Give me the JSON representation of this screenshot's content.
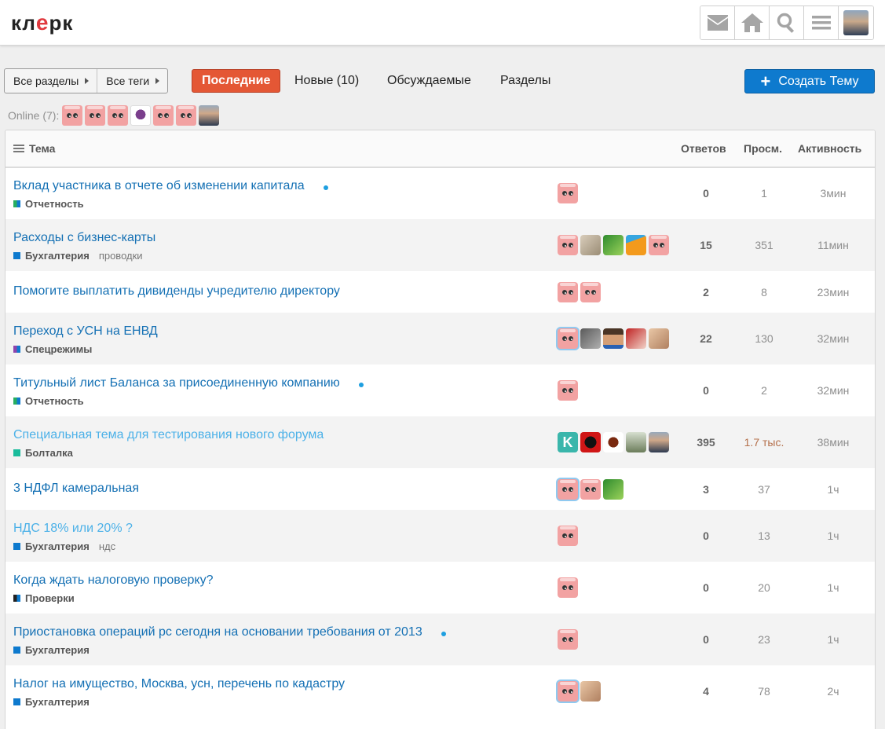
{
  "header": {
    "logo_text": "кл",
    "logo_clip": "e",
    "logo_tail": "рк",
    "icons": [
      "envelope-icon",
      "home-icon",
      "search-icon",
      "menu-icon"
    ]
  },
  "nav": {
    "categories_label": "Все разделы",
    "tags_label": "Все теги",
    "tabs": [
      "Последние",
      "Новые (10)",
      "Обсуждаемые",
      "Разделы"
    ],
    "create_label": "Создать Тему"
  },
  "online": {
    "label": "Online (7):"
  },
  "table": {
    "headers": {
      "topic": "Тема",
      "replies": "Ответов",
      "views": "Просм.",
      "activity": "Активность"
    },
    "rows": [
      {
        "title": "Вклад участника в отчете об изменении капитала",
        "new": true,
        "visited": false,
        "category": "Отчетность",
        "cat_colors": [
          "#27ae60",
          "#0e7ace"
        ],
        "tag": "",
        "avatars": [
          "pink"
        ],
        "replies": "0",
        "views": "1",
        "activity": "3мин"
      },
      {
        "title": "Расходы с бизнес-карты",
        "new": false,
        "visited": false,
        "category": "Бухгалтерия",
        "cat_colors": [
          "#0e7ace",
          "#0e7ace"
        ],
        "tag": "проводки",
        "avatars": [
          "pink",
          "cat",
          "green",
          "orange",
          "pink"
        ],
        "replies": "15",
        "views": "351",
        "activity": "11мин"
      },
      {
        "title": "Помогите выплатить дивиденды учредителю директору",
        "new": false,
        "visited": false,
        "category": "",
        "cat_colors": [],
        "tag": "",
        "avatars": [
          "pink",
          "pink"
        ],
        "replies": "2",
        "views": "8",
        "activity": "23мин"
      },
      {
        "title": "Переход с УСН на ЕНВД",
        "new": false,
        "visited": false,
        "category": "Спецрежимы",
        "cat_colors": [
          "#8e44ad",
          "#0e7ace"
        ],
        "tag": "",
        "avatars": [
          "pink-hl",
          "grey",
          "face",
          "red",
          "skin"
        ],
        "replies": "22",
        "views": "130",
        "activity": "32мин"
      },
      {
        "title": "Титульный лист Баланса за присоединенную компанию",
        "new": true,
        "visited": false,
        "category": "Отчетность",
        "cat_colors": [
          "#27ae60",
          "#0e7ace"
        ],
        "tag": "",
        "avatars": [
          "pink"
        ],
        "replies": "0",
        "views": "2",
        "activity": "32мин"
      },
      {
        "title": "Специальная тема для тестирования нового форума",
        "new": false,
        "visited": true,
        "category": "Болталка",
        "cat_colors": [
          "#1abc9c",
          "#1abc9c"
        ],
        "tag": "",
        "avatars": [
          "k",
          "devil",
          "imp",
          "eye",
          "man"
        ],
        "replies": "395",
        "views": "1.7 тыс.",
        "activity": "38мин"
      },
      {
        "title": "3 НДФЛ камеральная",
        "new": false,
        "visited": false,
        "category": "",
        "cat_colors": [],
        "tag": "",
        "avatars": [
          "pink-hl",
          "pink",
          "green"
        ],
        "replies": "3",
        "views": "37",
        "activity": "1ч"
      },
      {
        "title": "НДС 18% или 20% ?",
        "new": false,
        "visited": true,
        "category": "Бухгалтерия",
        "cat_colors": [
          "#0e7ace",
          "#0e7ace"
        ],
        "tag": "ндс",
        "avatars": [
          "pink"
        ],
        "replies": "0",
        "views": "13",
        "activity": "1ч"
      },
      {
        "title": "Когда ждать налоговую проверку?",
        "new": false,
        "visited": false,
        "category": "Проверки",
        "cat_colors": [
          "#222222",
          "#0e7ace"
        ],
        "tag": "",
        "avatars": [
          "pink"
        ],
        "replies": "0",
        "views": "20",
        "activity": "1ч"
      },
      {
        "title": "Приостановка операций рс сегодня на основании требования от 2013",
        "new": true,
        "visited": false,
        "category": "Бухгалтерия",
        "cat_colors": [
          "#0e7ace",
          "#0e7ace"
        ],
        "tag": "",
        "avatars": [
          "pink"
        ],
        "replies": "0",
        "views": "23",
        "activity": "1ч"
      },
      {
        "title": "Налог на имущество, Москва, усн, перечень по кадастру",
        "new": false,
        "visited": false,
        "category": "Бухгалтерия",
        "cat_colors": [
          "#0e7ace",
          "#0e7ace"
        ],
        "tag": "",
        "avatars": [
          "pink-hl",
          "skin"
        ],
        "replies": "4",
        "views": "78",
        "activity": "2ч"
      }
    ]
  }
}
